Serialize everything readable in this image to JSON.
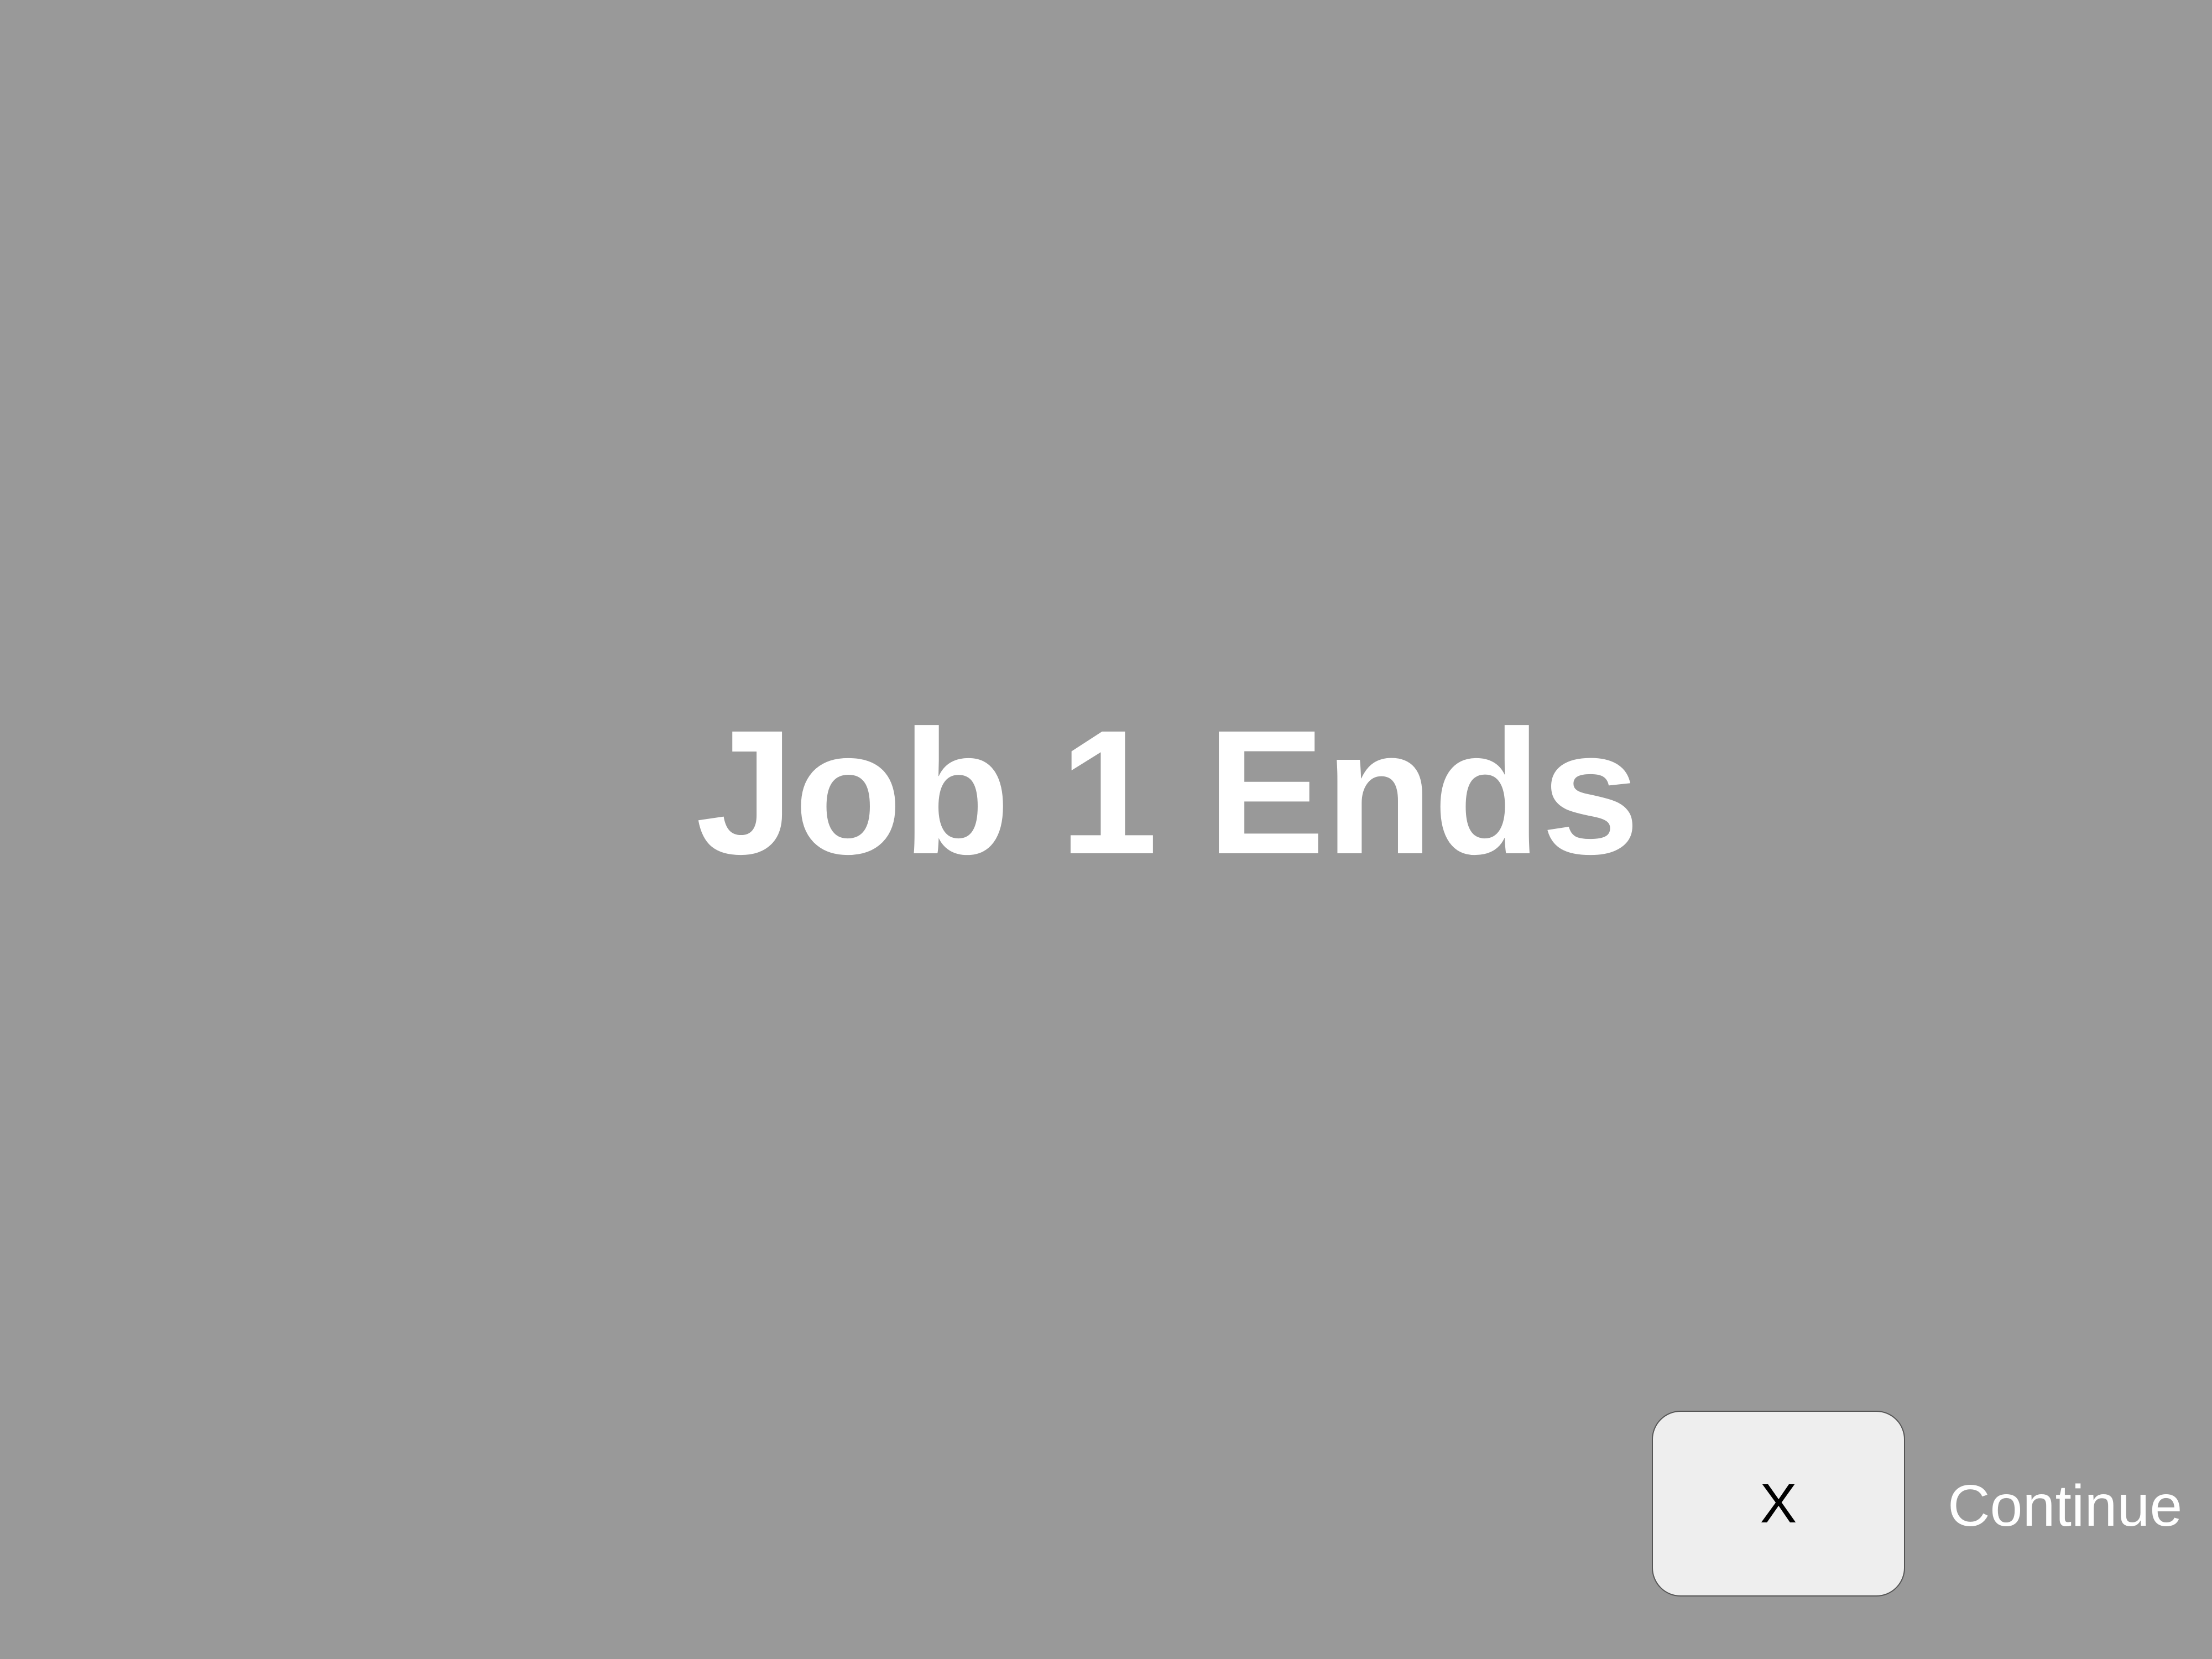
{
  "screen": {
    "title": "Job 1 Ends",
    "background_color": "#999999"
  },
  "continue_prompt": {
    "key_label": "X",
    "action_label": "Continue"
  }
}
